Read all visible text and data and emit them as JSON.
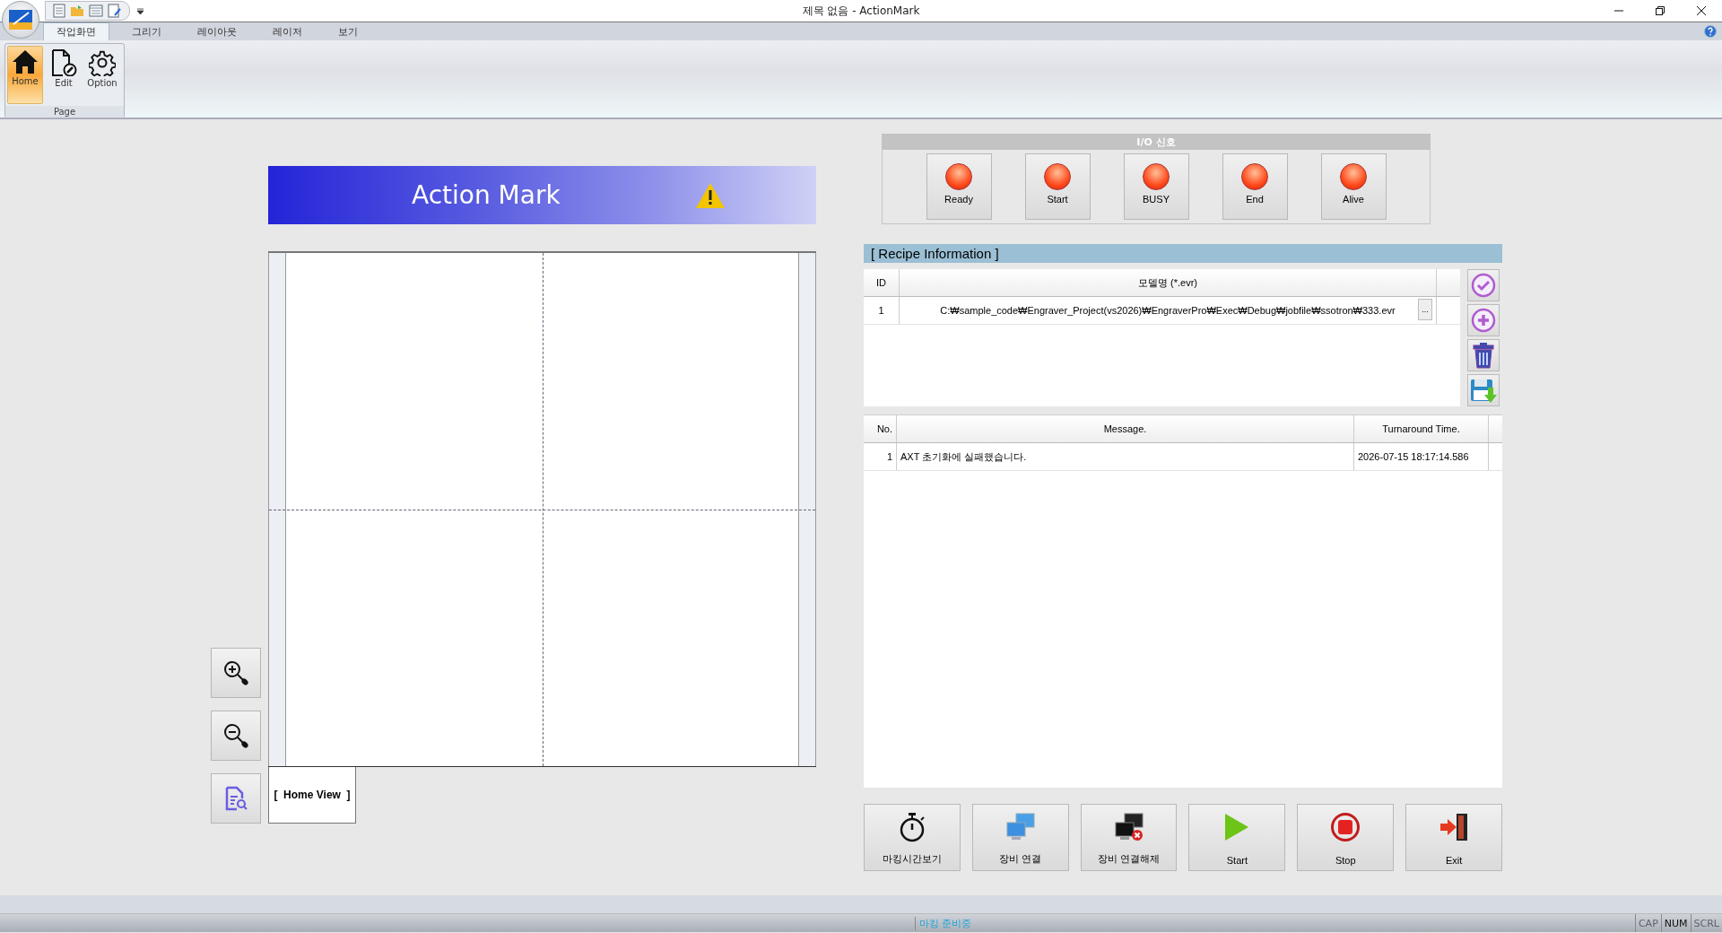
{
  "window": {
    "title": "제목 없음 - ActionMark"
  },
  "ribbon": {
    "tabs": [
      {
        "label": "작업화면",
        "selected": true
      },
      {
        "label": "그리기",
        "selected": false
      },
      {
        "label": "레이아웃",
        "selected": false
      },
      {
        "label": "레이저",
        "selected": false
      },
      {
        "label": "보기",
        "selected": false
      }
    ],
    "group": {
      "label": "Page",
      "buttons": [
        {
          "label": "Home",
          "kind": "home",
          "selected": true
        },
        {
          "label": "Edit",
          "kind": "edit",
          "selected": false
        },
        {
          "label": "Option",
          "kind": "gear",
          "selected": false
        }
      ]
    }
  },
  "banner": {
    "title": "Action Mark"
  },
  "view_tab": {
    "label": "[  Home View  ]"
  },
  "io_panel": {
    "title": "I/O 신호",
    "signals": [
      {
        "label": "Ready",
        "on": false
      },
      {
        "label": "Start",
        "on": false
      },
      {
        "label": "BUSY",
        "on": false
      },
      {
        "label": "End",
        "on": false
      },
      {
        "label": "Alive",
        "on": false
      }
    ]
  },
  "recipe": {
    "title": "[ Recipe Information ]",
    "columns": [
      "ID",
      "모델명 (*.evr)"
    ],
    "rows": [
      {
        "id": "1",
        "model": "C:₩sample_code₩Engraver_Project(vs2026)₩EngraverPro₩Exec₩Debug₩jobfile₩ssotron₩333.evr",
        "browse": "..."
      }
    ]
  },
  "messages": {
    "columns": [
      "No.",
      "Message.",
      "Turnaround Time."
    ],
    "rows": [
      {
        "no": "1",
        "message": "AXT 초기화에 실패했습니다.",
        "time": "2026-07-15 18:17:14.586"
      }
    ]
  },
  "buttons": [
    {
      "label": "마킹시간보기",
      "kind": "stopwatch"
    },
    {
      "label": "장비 연결",
      "kind": "connect"
    },
    {
      "label": "장비 연결해제",
      "kind": "disconnect"
    },
    {
      "label": "Start",
      "kind": "play"
    },
    {
      "label": "Stop",
      "kind": "stop"
    },
    {
      "label": "Exit",
      "kind": "exit"
    }
  ],
  "status_bar": {
    "message": "마킹 준비중",
    "indicators": [
      {
        "label": "CAP",
        "on": false
      },
      {
        "label": "NUM",
        "on": true
      },
      {
        "label": "SCRL",
        "on": false
      }
    ]
  }
}
